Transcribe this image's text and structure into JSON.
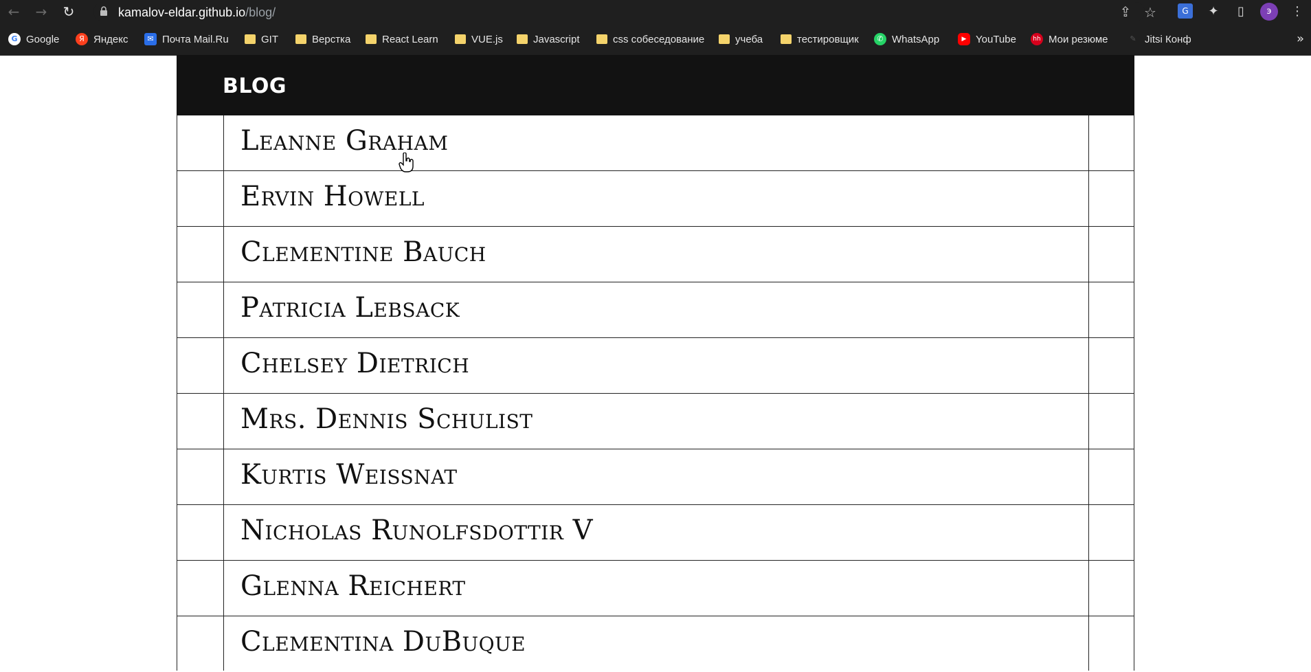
{
  "browser": {
    "url_host": "kamalov-eldar.github.io",
    "url_path": "/blog/",
    "avatar_letter": "э",
    "icons": [
      "back-icon",
      "forward-icon",
      "reload-icon",
      "lock-icon",
      "share-icon",
      "star-icon",
      "translate-icon",
      "extensions-icon",
      "side-panel-icon",
      "menu-icon"
    ]
  },
  "bookmarks": {
    "items": [
      {
        "label": "Google",
        "icon": "google-icon"
      },
      {
        "label": "Яндекс",
        "icon": "yandex-icon"
      },
      {
        "label": "Почта Mail.Ru",
        "icon": "mail-icon"
      },
      {
        "label": "GIT",
        "icon": "folder-icon"
      },
      {
        "label": "Верстка",
        "icon": "folder-icon"
      },
      {
        "label": "React Learn",
        "icon": "folder-icon"
      },
      {
        "label": "VUE.js",
        "icon": "folder-icon"
      },
      {
        "label": "Javascript",
        "icon": "folder-icon"
      },
      {
        "label": "css собеседование",
        "icon": "folder-icon"
      },
      {
        "label": "учеба",
        "icon": "folder-icon"
      },
      {
        "label": "тестировщик",
        "icon": "folder-icon"
      },
      {
        "label": "WhatsApp",
        "icon": "whatsapp-icon"
      },
      {
        "label": "YouTube",
        "icon": "youtube-icon"
      },
      {
        "label": "Мои резюме",
        "icon": "hh-icon"
      },
      {
        "label": "Jitsi Конф",
        "icon": "jitsi-icon"
      }
    ],
    "more": "»"
  },
  "page": {
    "title": "BLOG",
    "users": [
      "Leanne Graham",
      "Ervin Howell",
      "Clementine Bauch",
      "Patricia Lebsack",
      "Chelsey Dietrich",
      "Mrs. Dennis Schulist",
      "Kurtis Weissnat",
      "Nicholas Runolfsdottir V",
      "Glenna Reichert",
      "Clementina DuBuque"
    ]
  }
}
